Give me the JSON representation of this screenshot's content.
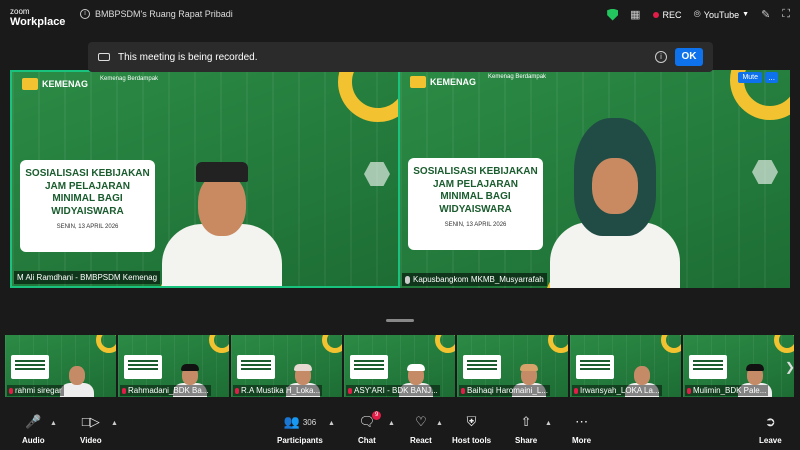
{
  "app": {
    "brand_line1": "zoom",
    "brand_line2": "Workplace"
  },
  "meeting": {
    "title": "BMBPSDM's Ruang Rapat Pribadi"
  },
  "topbar": {
    "rec_label": "REC",
    "stream_label": "YouTube"
  },
  "banner": {
    "text": "This meeting is being recorded.",
    "ok_label": "OK"
  },
  "slide": {
    "org": "KEMENAG",
    "tagline": "Kemenag Berdampak",
    "title": "SOSIALISASI KEBIJAKAN JAM PELAJARAN MINIMAL BAGI WIDYAISWARA",
    "date": "SENIN, 13 APRIL 2026"
  },
  "tiles": [
    {
      "name": "M Ali Ramdhani - BMBPSDM Kemenag"
    },
    {
      "name": "Kapusbangkom MKMB_Musyarrafah",
      "mute_label": "Mute",
      "more_label": "..."
    }
  ],
  "strip": [
    {
      "name": "rahmi siregar",
      "hat": "none"
    },
    {
      "name": "Rahmadani_BDK Ba...",
      "hat": "#111111"
    },
    {
      "name": "R.A Mustika H_Loka...",
      "hat": "#e5d9d1"
    },
    {
      "name": "ASY'ARI - BDK BANJ...",
      "hat": "#ffffff"
    },
    {
      "name": "Baihaqi Haromaini_L...",
      "hat": "#d8a36b"
    },
    {
      "name": "Irwansyah_LOKA La...",
      "hat": "none"
    },
    {
      "name": "Mulimin_BDK Pale...",
      "hat": "#111111"
    }
  ],
  "toolbar": {
    "audio": "Audio",
    "video": "Video",
    "participants": "Participants",
    "participants_count": "306",
    "chat": "Chat",
    "chat_badge": "9",
    "react": "React",
    "host_tools": "Host tools",
    "share": "Share",
    "more": "More",
    "leave": "Leave"
  },
  "colors": {
    "accent": "#0e72ed",
    "speaker_border": "#19c37d",
    "slide_green": "#1f7a3a",
    "slide_yellow": "#f2c230",
    "danger": "#e11d48"
  }
}
